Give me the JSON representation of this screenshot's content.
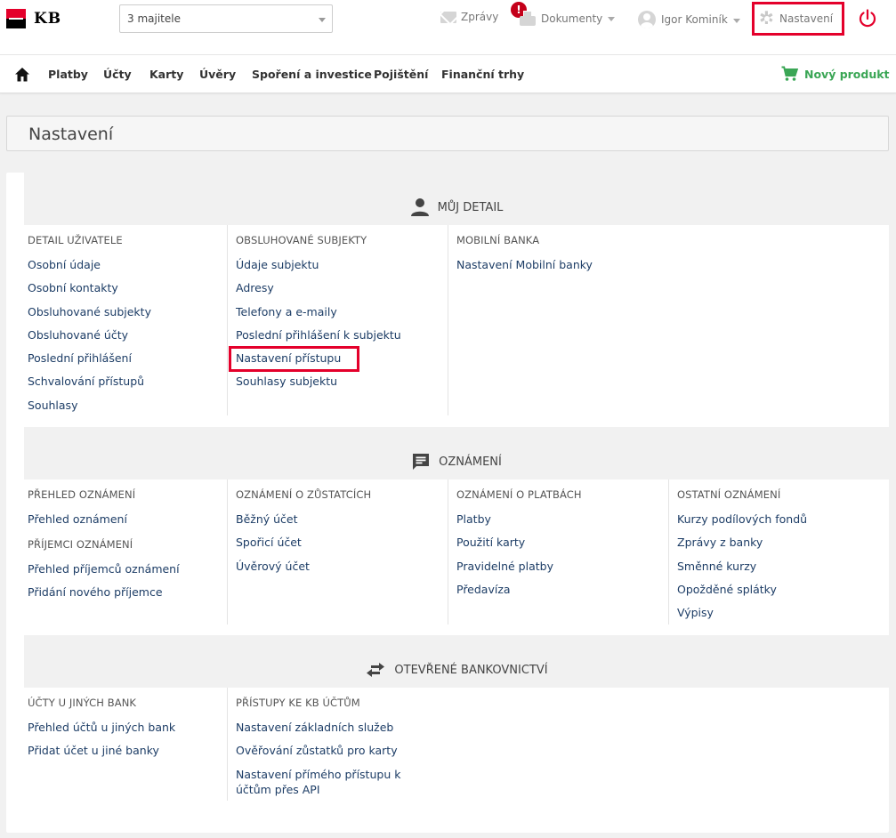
{
  "brand": {
    "name": "KB",
    "accent": "#e4002b"
  },
  "topbar": {
    "subject_select": "3 majitele",
    "messages": "Zprávy",
    "documents": "Dokumenty",
    "documents_badge": "!",
    "user": "Igor Kominík",
    "settings": "Nastavení"
  },
  "nav": {
    "items": [
      "Platby",
      "Účty",
      "Karty",
      "Úvěry",
      "Spoření a investice",
      "Pojištění",
      "Finanční trhy"
    ],
    "new_product": "Nový produkt"
  },
  "page": {
    "title": "Nastavení"
  },
  "sections": [
    {
      "title": "MŮJ DETAIL",
      "icon": "person-icon",
      "columns": [
        {
          "groups": [
            {
              "heading": "DETAIL UŽIVATELE",
              "links": [
                "Osobní údaje",
                "Osobní kontakty",
                "Obsluhované subjekty",
                "Obsluhované účty",
                "Poslední přihlášení",
                "Schvalování přístupů",
                "Souhlasy"
              ]
            }
          ]
        },
        {
          "groups": [
            {
              "heading": "OBSLUHOVANÉ SUBJEKTY",
              "links": [
                "Údaje subjektu",
                "Adresy",
                "Telefony a e-maily",
                "Poslední přihlášení k subjektu",
                "Nastavení přístupu",
                "Souhlasy subjektu"
              ]
            }
          ]
        },
        {
          "groups": [
            {
              "heading": "MOBILNÍ BANKA",
              "links": [
                "Nastavení Mobilní banky"
              ]
            }
          ]
        }
      ]
    },
    {
      "title": "OZNÁMENÍ",
      "icon": "chat-icon",
      "columns": [
        {
          "groups": [
            {
              "heading": "PŘEHLED OZNÁMENÍ",
              "links": [
                "Přehled oznámení"
              ]
            },
            {
              "heading": "PŘÍJEMCI OZNÁMENÍ",
              "links": [
                "Přehled příjemců oznámení",
                "Přidání nového příjemce"
              ]
            }
          ]
        },
        {
          "groups": [
            {
              "heading": "OZNÁMENÍ O ZŮSTATCÍCH",
              "links": [
                "Běžný účet",
                "Spořicí účet",
                "Úvěrový účet"
              ]
            }
          ]
        },
        {
          "groups": [
            {
              "heading": "OZNÁMENÍ O PLATBÁCH",
              "links": [
                "Platby",
                "Použití karty",
                "Pravidelné platby",
                "Předavíza"
              ]
            }
          ]
        },
        {
          "groups": [
            {
              "heading": "OSTATNÍ OZNÁMENÍ",
              "links": [
                "Kurzy podílových fondů",
                "Zprávy z banky",
                "Směnné kurzy",
                "Opožděné splátky",
                "Výpisy"
              ]
            }
          ]
        }
      ]
    },
    {
      "title": "OTEVŘENÉ BANKOVNICTVÍ",
      "icon": "swap-arrows-icon",
      "columns": [
        {
          "groups": [
            {
              "heading": "ÚČTY U JINÝCH BANK",
              "links": [
                "Přehled účtů u jiných bank",
                "Přidat účet u jiné banky"
              ]
            }
          ]
        },
        {
          "groups": [
            {
              "heading": "PŘÍSTUPY KE KB ÚČTŮM",
              "links": [
                "Nastavení základních služeb",
                "Ověřování zůstatků pro karty",
                "Nastavení přímého přístupu k účtům přes API"
              ]
            }
          ]
        }
      ]
    }
  ]
}
